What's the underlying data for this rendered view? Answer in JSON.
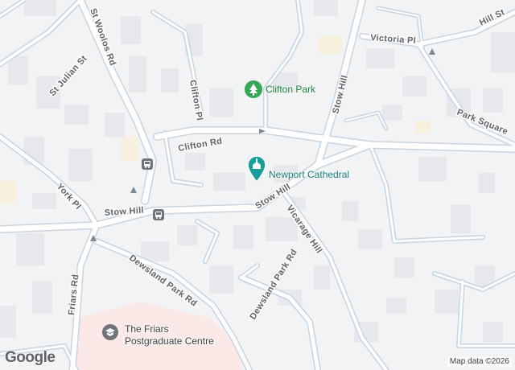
{
  "map": {
    "roads": {
      "st_woolos": "St Woolos Rd",
      "st_julian": "St Julian St",
      "clifton_pl": "Clifton Pl",
      "clifton_rd": "Clifton Rd",
      "york_pl": "York Pl",
      "stow_hill_west": "Stow Hill",
      "stow_hill_mid": "Stow Hill",
      "stow_hill_north": "Stow Hill",
      "vicarage_hill": "Vicarage Hill",
      "dewsland_park_rd_west": "Dewsland Park Rd",
      "dewsland_park_rd_east": "Dewsland Park Rd",
      "friars_rd": "Friars Rd",
      "victoria_pl": "Victoria Pl",
      "hill_st": "Hill St",
      "park_square": "Park Square"
    },
    "pois": {
      "clifton_park": "Clifton Park",
      "cathedral": "Newport Cathedral",
      "friars_line1": "The Friars",
      "friars_line2": "Postgraduate Centre"
    },
    "icons": {
      "park": "tree-icon",
      "cathedral": "church-icon",
      "friars": "school-icon",
      "bus": "bus-stop-icon"
    },
    "colors": {
      "land": "#f2f3f5",
      "road": "#ffffff",
      "road_edge": "#c8d4de",
      "building": "#e6e8eb",
      "park_pin": "#34a853",
      "cathedral_pin": "#1a9e9c",
      "campus_area": "#fbe9e7"
    }
  },
  "logo": {
    "text": "Google"
  },
  "attribution": "Map data ©2026"
}
